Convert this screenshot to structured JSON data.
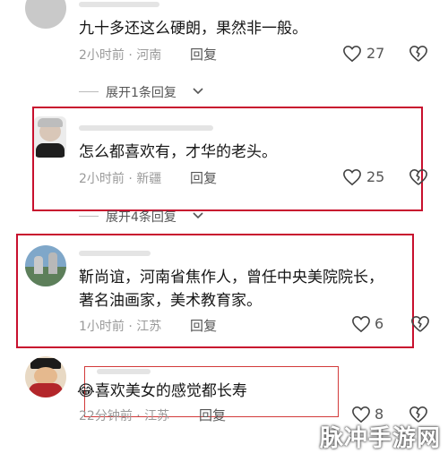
{
  "comments": [
    {
      "text": "九十多还这么硬朗，果然非一般。",
      "meta": "2小时前 · 河南",
      "reply_label": "回复",
      "likes": "27"
    },
    {
      "text": "怎么都喜欢有，才华的老头。",
      "meta": "2小时前 · 新疆",
      "reply_label": "回复",
      "likes": "25"
    },
    {
      "text_line1": "靳尚谊，河南省焦作人，曾任中央美院院长，",
      "text_line2": "著名油画家，美术教育家。",
      "meta": "1小时前 · 江苏",
      "reply_label": "回复",
      "likes": "6"
    },
    {
      "emoji": "😂",
      "text": "喜欢美女的感觉都长寿",
      "meta": "22分钟前 · 江苏",
      "reply_label": "回复",
      "likes": "8"
    }
  ],
  "expand_replies": [
    "展开1条回复",
    "展开4条回复"
  ],
  "watermark": "脉冲手游网",
  "colors": {
    "highlight_box": "#c8102e",
    "meta_text": "#9a9a9a"
  }
}
